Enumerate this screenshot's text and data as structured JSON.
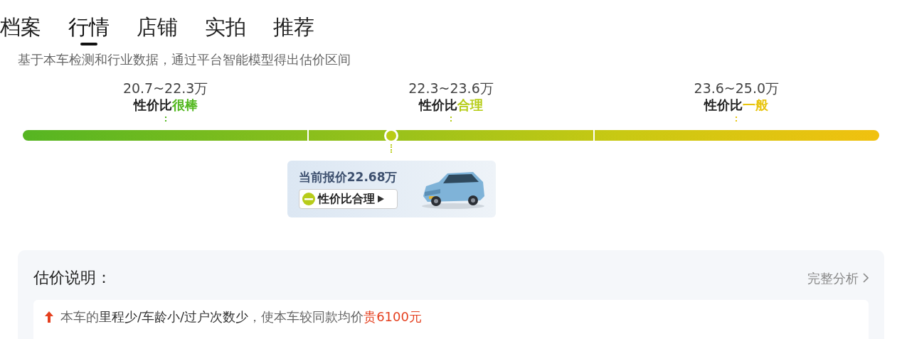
{
  "tabs": [
    {
      "label": "档案",
      "selected": false
    },
    {
      "label": "行情",
      "selected": true
    },
    {
      "label": "店铺",
      "selected": false
    },
    {
      "label": "实拍",
      "selected": false
    },
    {
      "label": "推荐",
      "selected": false
    }
  ],
  "description": "基于本车检测和行业数据，通过平台智能模型得出估价区间",
  "price_ranges": [
    {
      "range": "20.7~22.3万",
      "label": "性价比",
      "rating": "很棒",
      "color": "#52b81e"
    },
    {
      "range": "22.3~23.6万",
      "label": "性价比",
      "rating": "合理",
      "color": "#b5cc14"
    },
    {
      "range": "23.6~25.0万",
      "label": "性价比",
      "rating": "一般",
      "color": "#e8c40c"
    }
  ],
  "current": {
    "level": 0.43,
    "price": "当前报价22.68万",
    "badge": "性价比合理"
  },
  "explanation": {
    "title": "估价说明：",
    "link": "完整分析",
    "items": [
      {
        "text": "本车的**里程少/车龄小/过户次数少**，使本车较同款均价",
        "amount": "贵6100元",
        "color": "#e5401f"
      }
    ]
  }
}
